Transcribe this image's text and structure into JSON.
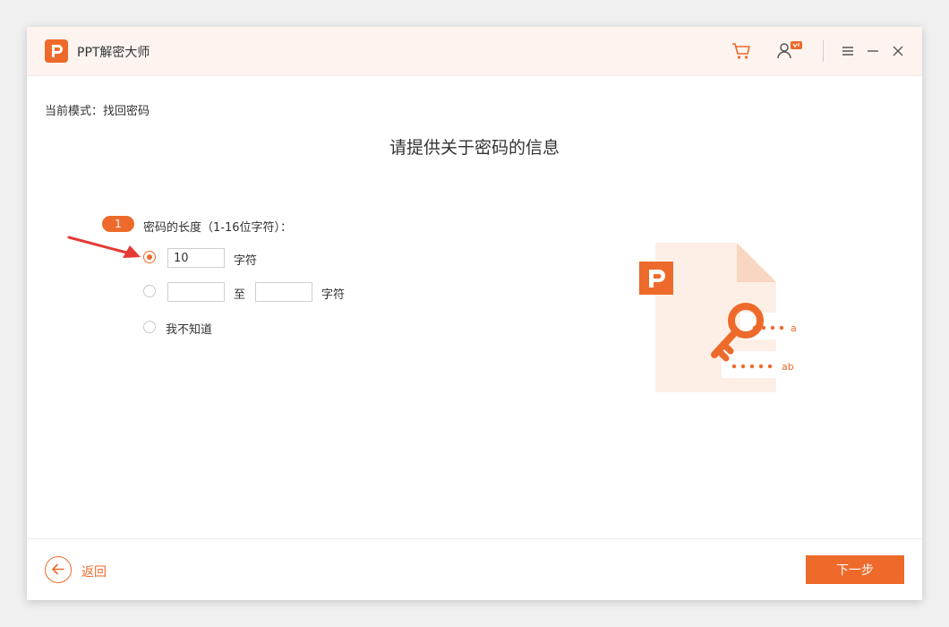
{
  "app": {
    "title": "PPT解密大师"
  },
  "colors": {
    "accent": "#ee6a2b",
    "title_bg": "#fdf4ef",
    "illustration_bg": "#fdefe6"
  },
  "titlebar": {
    "icons": [
      "cart-icon",
      "user-vip-icon",
      "menu-icon",
      "minimize-icon",
      "close-icon"
    ]
  },
  "mode": {
    "label": "当前模式：找回密码"
  },
  "page": {
    "title": "请提供关于密码的信息"
  },
  "question": {
    "step": "1",
    "label": "密码的长度（1-16位字符）："
  },
  "options": {
    "exact": {
      "selected": true,
      "value": "10",
      "unit": "字符"
    },
    "range": {
      "selected": false,
      "from": "",
      "to_label": "至",
      "to": "",
      "unit": "字符"
    },
    "unknown": {
      "selected": false,
      "label": "我不知道"
    }
  },
  "illustration": {
    "line1": "a",
    "line2": "ab"
  },
  "footer": {
    "back_label": "返回",
    "next_label": "下一步"
  }
}
